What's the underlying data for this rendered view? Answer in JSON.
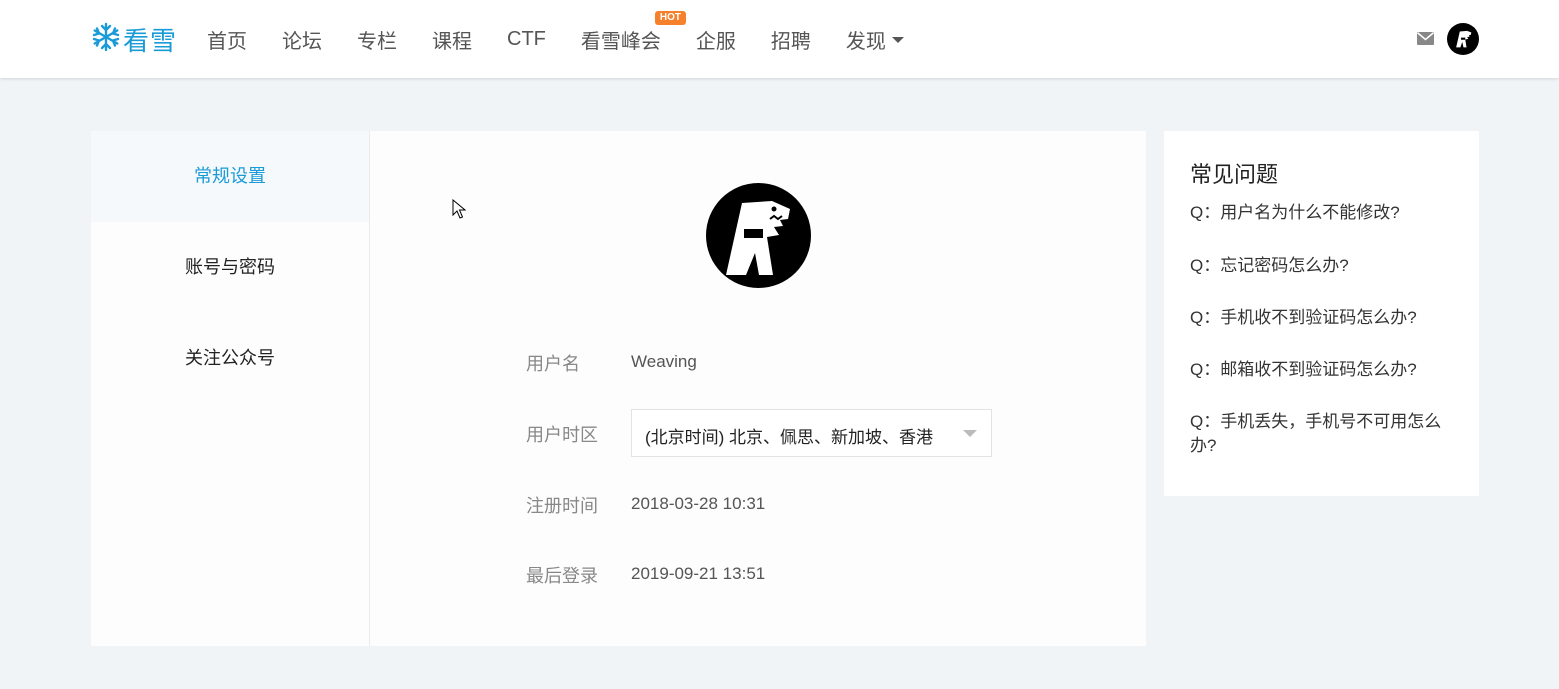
{
  "brand": {
    "name": "看雪",
    "logo_icon": "snowflake-icon",
    "color": "#1a9bd7"
  },
  "nav": {
    "items": [
      {
        "label": "首页"
      },
      {
        "label": "论坛"
      },
      {
        "label": "专栏"
      },
      {
        "label": "课程"
      },
      {
        "label": "CTF"
      },
      {
        "label": "看雪峰会",
        "badge": "HOT"
      },
      {
        "label": "企服"
      },
      {
        "label": "招聘"
      },
      {
        "label": "发现",
        "dropdown": true
      }
    ]
  },
  "header_icons": {
    "mail": "mail-icon",
    "avatar": "user-avatar"
  },
  "sidebar": {
    "items": [
      {
        "label": "常规设置",
        "active": true
      },
      {
        "label": "账号与密码"
      },
      {
        "label": "关注公众号"
      }
    ]
  },
  "profile": {
    "username_label": "用户名",
    "username": "Weaving",
    "timezone_label": "用户时区",
    "timezone": "(北京时间) 北京、佩思、新加坡、香港",
    "registered_label": "注册时间",
    "registered": "2018-03-28 10:31",
    "last_login_label": "最后登录",
    "last_login": "2019-09-21 13:51"
  },
  "faq": {
    "title": "常见问题",
    "items": [
      "Q：用户名为什么不能修改?",
      "Q：忘记密码怎么办?",
      "Q：手机收不到验证码怎么办?",
      "Q：邮箱收不到验证码怎么办?",
      "Q：手机丢失，手机号不可用怎么办?"
    ]
  },
  "colors": {
    "accent": "#1a9bd7",
    "hot_badge": "#f7812b",
    "background": "#f0f4f7"
  }
}
